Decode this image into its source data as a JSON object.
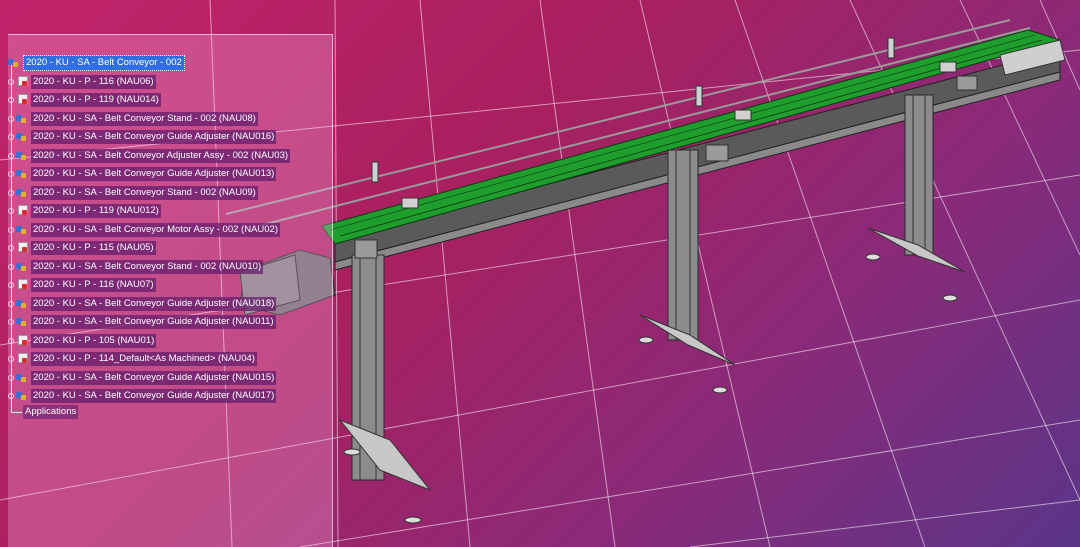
{
  "tree": {
    "root": {
      "label": "2020 - KU - SA - Belt Conveyor - 002",
      "icon": "assembly-icon",
      "selected": true
    },
    "children": [
      {
        "label": "2020 - KU - P - 116 (NAU06)",
        "icon": "part-icon"
      },
      {
        "label": "2020 - KU - P - 119 (NAU014)",
        "icon": "part-icon"
      },
      {
        "label": "2020 - KU - SA - Belt Conveyor Stand - 002 (NAU08)",
        "icon": "assembly-icon"
      },
      {
        "label": "2020 - KU - SA - Belt Conveyor Guide Adjuster (NAU016)",
        "icon": "assembly-icon"
      },
      {
        "label": "2020 - KU - SA - Belt Conveyor Adjuster Assy - 002 (NAU03)",
        "icon": "assembly-icon"
      },
      {
        "label": "2020 - KU - SA - Belt Conveyor Guide Adjuster (NAU013)",
        "icon": "assembly-icon"
      },
      {
        "label": "2020 - KU - SA - Belt Conveyor Stand - 002 (NAU09)",
        "icon": "assembly-icon"
      },
      {
        "label": "2020 - KU - P - 119 (NAU012)",
        "icon": "part-icon"
      },
      {
        "label": "2020 - KU - SA - Belt Conveyor Motor Assy - 002 (NAU02)",
        "icon": "assembly-icon"
      },
      {
        "label": "2020 - KU - P - 115 (NAU05)",
        "icon": "part-icon"
      },
      {
        "label": "2020 - KU - SA - Belt Conveyor Stand - 002 (NAU010)",
        "icon": "assembly-icon"
      },
      {
        "label": "2020 - KU - P - 116 (NAU07)",
        "icon": "part-icon"
      },
      {
        "label": "2020 - KU - SA - Belt Conveyor Guide Adjuster (NAU018)",
        "icon": "assembly-icon"
      },
      {
        "label": "2020 - KU - SA - Belt Conveyor Guide Adjuster (NAU011)",
        "icon": "assembly-icon"
      },
      {
        "label": "2020 - KU - P - 105 (NAU01)",
        "icon": "part-icon"
      },
      {
        "label": "2020 - KU - P - 114_Default<As Machined> (NAU04)",
        "icon": "part-icon"
      },
      {
        "label": "2020 - KU - SA - Belt Conveyor Guide Adjuster (NAU015)",
        "icon": "assembly-icon"
      },
      {
        "label": "2020 - KU - SA - Belt Conveyor Guide Adjuster (NAU017)",
        "icon": "assembly-icon"
      }
    ],
    "applications": {
      "label": "Applications"
    }
  },
  "colors": {
    "background_start": "#c2246a",
    "background_end": "#5a3588",
    "belt": "#1f9e2e",
    "frame": "#b8b8b8",
    "selection": "#2f6fe0"
  }
}
